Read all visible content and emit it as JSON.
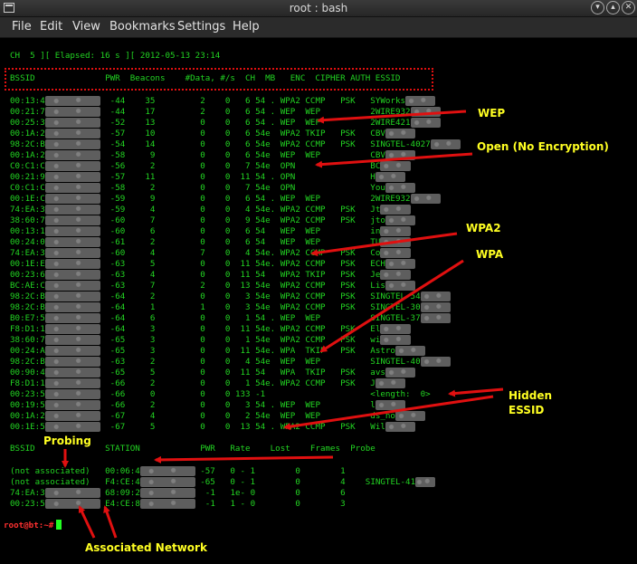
{
  "window": {
    "title": "root : bash"
  },
  "menu": [
    "File",
    "Edit",
    "View",
    "Bookmarks",
    "Settings",
    "Help"
  ],
  "status_line": "CH  5 ][ Elapsed: 16 s ][ 2012-05-13 23:14",
  "ap_header": "BSSID              PWR  Beacons    #Data, #/s  CH  MB   ENC  CIPHER AUTH ESSID",
  "ap_rows": [
    [
      "00:13:4",
      "-44",
      "35",
      "2",
      "0",
      "6",
      "54 .",
      "WPA2",
      "CCMP",
      "PSK",
      "SYWorks"
    ],
    [
      "00:21:7",
      "-44",
      "17",
      "2",
      "0",
      "6",
      "54 .",
      "WEP",
      "WEP",
      "",
      "2WIRE932"
    ],
    [
      "00:25:3",
      "-52",
      "13",
      "0",
      "0",
      "6",
      "54 .",
      "WEP",
      "WEP",
      "",
      "2WIRE421"
    ],
    [
      "00:1A:2",
      "-57",
      "10",
      "0",
      "0",
      "6",
      "54e",
      "WPA2",
      "TKIP",
      "PSK",
      "CBV"
    ],
    [
      "98:2C:B",
      "-54",
      "14",
      "0",
      "0",
      "6",
      "54e",
      "WPA2",
      "CCMP",
      "PSK",
      "SINGTEL-4027"
    ],
    [
      "00:1A:2",
      "-58",
      "9",
      "0",
      "0",
      "6",
      "54e",
      "WEP",
      "WEP",
      "",
      "CBV"
    ],
    [
      "C0:C1:C",
      "-56",
      "2",
      "0",
      "0",
      "7",
      "54e",
      "OPN",
      "",
      "",
      "BC"
    ],
    [
      "00:21:9",
      "-57",
      "11",
      "0",
      "0",
      "11",
      "54 .",
      "OPN",
      "",
      "",
      "H"
    ],
    [
      "C0:C1:C",
      "-58",
      "2",
      "0",
      "0",
      "7",
      "54e",
      "OPN",
      "",
      "",
      "You"
    ],
    [
      "00:1E:C",
      "-59",
      "9",
      "0",
      "0",
      "6",
      "54 .",
      "WEP",
      "WEP",
      "",
      "2WIRE932"
    ],
    [
      "74:EA:3",
      "-59",
      "4",
      "0",
      "0",
      "4",
      "54e.",
      "WPA2",
      "CCMP",
      "PSK",
      "Jt"
    ],
    [
      "38:60:7",
      "-60",
      "7",
      "0",
      "0",
      "9",
      "54e",
      "WPA2",
      "CCMP",
      "PSK",
      "jto"
    ],
    [
      "00:13:1",
      "-60",
      "6",
      "0",
      "0",
      "6",
      "54",
      "WEP",
      "WEP",
      "",
      "in"
    ],
    [
      "00:24:0",
      "-61",
      "2",
      "0",
      "0",
      "6",
      "54",
      "WEP",
      "WEP",
      "",
      "TU"
    ],
    [
      "74:EA:3",
      "-60",
      "4",
      "7",
      "0",
      "4",
      "54e.",
      "WPA2",
      "CCMP",
      "PSK",
      "Co"
    ],
    [
      "00:1E:E",
      "-63",
      "5",
      "0",
      "0",
      "11",
      "54e.",
      "WPA2",
      "CCMP",
      "PSK",
      "ECH"
    ],
    [
      "00:23:6",
      "-63",
      "4",
      "0",
      "0",
      "11",
      "54",
      "WPA2",
      "TKIP",
      "PSK",
      "Je"
    ],
    [
      "BC:AE:C",
      "-63",
      "7",
      "2",
      "0",
      "13",
      "54e",
      "WPA2",
      "CCMP",
      "PSK",
      "Lis"
    ],
    [
      "98:2C:B",
      "-64",
      "2",
      "0",
      "0",
      "3",
      "54e",
      "WPA2",
      "CCMP",
      "PSK",
      "SINGTEL-54"
    ],
    [
      "98:2C:B",
      "-64",
      "1",
      "1",
      "0",
      "3",
      "54e",
      "WPA2",
      "CCMP",
      "PSK",
      "SINGTEL-30"
    ],
    [
      "B0:E7:5",
      "-64",
      "6",
      "0",
      "0",
      "1",
      "54 .",
      "WEP",
      "WEP",
      "",
      "SINGTEL-37"
    ],
    [
      "F8:D1:1",
      "-64",
      "3",
      "0",
      "0",
      "11",
      "54e.",
      "WPA2",
      "CCMP",
      "PSK",
      "El"
    ],
    [
      "38:60:7",
      "-65",
      "3",
      "0",
      "0",
      "1",
      "54e",
      "WPA2",
      "CCMP",
      "PSK",
      "wi"
    ],
    [
      "00:24:A",
      "-65",
      "3",
      "0",
      "0",
      "11",
      "54e.",
      "WPA",
      "TKIP",
      "PSK",
      "Astro"
    ],
    [
      "98:2C:B",
      "-63",
      "2",
      "0",
      "0",
      "4",
      "54e",
      "WEP",
      "WEP",
      "",
      "SINGTEL-40"
    ],
    [
      "00:90:4",
      "-65",
      "5",
      "0",
      "0",
      "11",
      "54",
      "WPA",
      "TKIP",
      "PSK",
      "avs"
    ],
    [
      "F8:D1:1",
      "-66",
      "2",
      "0",
      "0",
      "1",
      "54e.",
      "WPA2",
      "CCMP",
      "PSK",
      "J"
    ],
    [
      "00:23:5",
      "-66",
      "0",
      "0",
      "0",
      "133",
      "-1",
      "",
      "",
      "",
      "<length:  0>"
    ],
    [
      "00:19:5",
      "-66",
      "2",
      "0",
      "0",
      "3",
      "54 .",
      "WEP",
      "WEP",
      "",
      "l"
    ],
    [
      "00:1A:2",
      "-67",
      "4",
      "0",
      "0",
      "2",
      "54e",
      "WEP",
      "WEP",
      "",
      "ds_no"
    ],
    [
      "00:1E:5",
      "-67",
      "5",
      "0",
      "0",
      "13",
      "54 .",
      "WPA2",
      "CCMP",
      "PSK",
      "Wil"
    ]
  ],
  "station_header": "BSSID              STATION            PWR   Rate    Lost    Frames  Probe",
  "station_rows": [
    [
      "(not associated)",
      "00:06:4",
      "-57",
      "0 - 1",
      "0",
      "1",
      ""
    ],
    [
      "(not associated)",
      "F4:CE:4",
      "-65",
      "0 - 1",
      "0",
      "4",
      "SINGTEL-41"
    ],
    [
      "74:EA:3",
      "68:09:2",
      "-1",
      "1e- 0",
      "0",
      "6",
      ""
    ],
    [
      "00:23:5",
      "E4:CE:8",
      "-1",
      "1 - 0",
      "0",
      "3",
      ""
    ]
  ],
  "prompt": "root@bt:~#",
  "annotations": {
    "wep": "WEP",
    "open": "Open (No Encryption)",
    "wpa2": "WPA2",
    "wpa": "WPA",
    "hidden_1": "Hidden",
    "hidden_2": "ESSID",
    "probing": "Probing",
    "associated": "Associated Network"
  },
  "colors": {
    "terminal_text": "#22d422",
    "annotation": "#ffff22",
    "arrow": "#e01010",
    "prompt": "#ff3030"
  }
}
